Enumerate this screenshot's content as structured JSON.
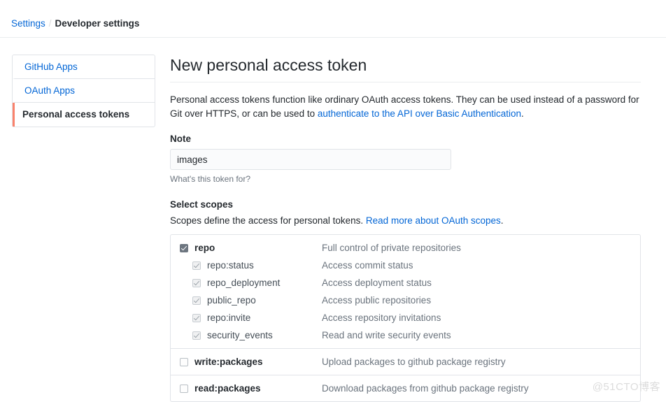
{
  "breadcrumb": {
    "root": "Settings",
    "separator": "/",
    "current": "Developer settings"
  },
  "sidebar": {
    "items": [
      {
        "label": "GitHub Apps",
        "active": false
      },
      {
        "label": "OAuth Apps",
        "active": false
      },
      {
        "label": "Personal access tokens",
        "active": true
      }
    ]
  },
  "main": {
    "title": "New personal access token",
    "intro": {
      "text_before": "Personal access tokens function like ordinary OAuth access tokens. They can be used instead of a password for Git over HTTPS, or can be used to ",
      "link": "authenticate to the API over Basic Authentication",
      "text_after": "."
    },
    "note": {
      "label": "Note",
      "value": "images",
      "placeholder": "",
      "help": "What's this token for?"
    },
    "scopes": {
      "title": "Select scopes",
      "sub_before": "Scopes define the access for personal tokens. ",
      "sub_link": "Read more about OAuth scopes",
      "sub_after": ".",
      "groups": [
        {
          "name": "repo",
          "description": "Full control of private repositories",
          "checkbox": "checked",
          "children": [
            {
              "name": "repo:status",
              "description": "Access commit status",
              "checkbox": "checked-disabled"
            },
            {
              "name": "repo_deployment",
              "description": "Access deployment status",
              "checkbox": "checked-disabled"
            },
            {
              "name": "public_repo",
              "description": "Access public repositories",
              "checkbox": "checked-disabled"
            },
            {
              "name": "repo:invite",
              "description": "Access repository invitations",
              "checkbox": "checked-disabled"
            },
            {
              "name": "security_events",
              "description": "Read and write security events",
              "checkbox": "checked-disabled"
            }
          ]
        },
        {
          "name": "write:packages",
          "description": "Upload packages to github package registry",
          "checkbox": "unchecked",
          "children": []
        },
        {
          "name": "read:packages",
          "description": "Download packages from github package registry",
          "checkbox": "unchecked",
          "children": []
        }
      ]
    }
  },
  "watermark": "@51CTO博客",
  "colors": {
    "link": "#0366d6",
    "active_border": "#f9826c",
    "text": "#24292e",
    "muted": "#6a737d",
    "border": "#e1e4e8"
  }
}
